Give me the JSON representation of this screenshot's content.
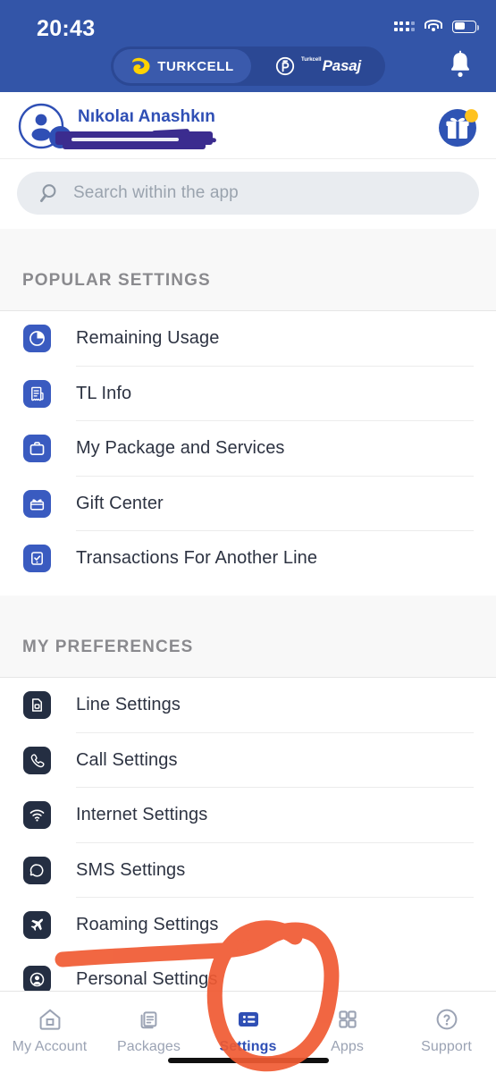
{
  "status_bar": {
    "time": "20:43",
    "signal_icon": "signal-dots-icon",
    "wifi_icon": "wifi-icon",
    "battery_icon": "battery-icon"
  },
  "brand_toggle": {
    "tabs": [
      {
        "label": "TURKCELL",
        "icon": "turkcell-logo-icon",
        "active": true
      },
      {
        "label": "Pasaj",
        "prefix": "Turkcell",
        "icon": "pasaj-logo-icon",
        "active": false
      }
    ]
  },
  "header": {
    "notification_icon": "bell-icon",
    "avatar_icon": "user-avatar-icon",
    "add_line_icon": "plus-badge-icon",
    "user_name": "Nıkolaı Anashkın",
    "phone_number_redacted": "",
    "gift_icon": "gift-icon",
    "gift_badge": ""
  },
  "search": {
    "placeholder": "Search within the app",
    "value": "",
    "icon": "search-icon"
  },
  "sections": [
    {
      "id": "popular",
      "title": "POPULAR SETTINGS",
      "icon_style": "blue",
      "items": [
        {
          "label": "Remaining Usage",
          "icon": "pie-chart-icon"
        },
        {
          "label": "TL Info",
          "icon": "invoice-icon"
        },
        {
          "label": "My Package and Services",
          "icon": "briefcase-icon"
        },
        {
          "label": "Gift Center",
          "icon": "gift-box-icon"
        },
        {
          "label": "Transactions For Another Line",
          "icon": "clipboard-check-icon"
        }
      ]
    },
    {
      "id": "preferences",
      "title": "MY PREFERENCES",
      "icon_style": "dark",
      "items": [
        {
          "label": "Line Settings",
          "icon": "sim-card-icon"
        },
        {
          "label": "Call Settings",
          "icon": "phone-icon"
        },
        {
          "label": "Internet Settings",
          "icon": "wifi-icon"
        },
        {
          "label": "SMS Settings",
          "icon": "chat-bubble-icon"
        },
        {
          "label": "Roaming Settings",
          "icon": "airplane-icon"
        }
      ],
      "clipped_item": {
        "label": "Personal Settings",
        "icon": "user-circle-icon"
      }
    }
  ],
  "bottom_nav": {
    "items": [
      {
        "label": "My Account",
        "icon": "home-icon",
        "active": false
      },
      {
        "label": "Packages",
        "icon": "documents-icon",
        "active": false
      },
      {
        "label": "Settings",
        "icon": "list-settings-icon",
        "active": true
      },
      {
        "label": "Apps",
        "icon": "grid-apps-icon",
        "active": false
      },
      {
        "label": "Support",
        "icon": "question-circle-icon",
        "active": false
      }
    ]
  },
  "annotation": {
    "circle_target": "Settings",
    "color": "#F05A32",
    "shapes": [
      "circle-around-settings-tab",
      "horizontal-stroke"
    ]
  },
  "colors": {
    "brand_blue": "#3355A8",
    "accent_blue": "#2F4FB5",
    "icon_blue": "#3A5BC0",
    "icon_dark": "#242E42",
    "band_bg": "#F8F8F8",
    "annotation_orange": "#F05A32"
  }
}
